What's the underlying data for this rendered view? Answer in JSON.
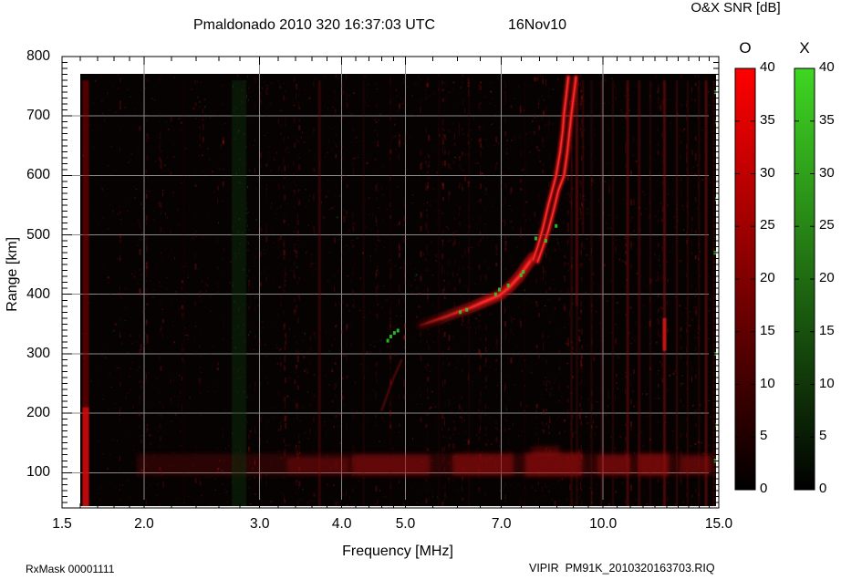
{
  "title": {
    "main": "Pmaldonado 2010 320 16:37:03 UTC",
    "date": "16Nov10"
  },
  "colorbar_title": "O&X SNR [dB]",
  "footer": {
    "left": "RxMask 00001111",
    "right": "VIPIR  PM91K_2010320163703.RIQ"
  },
  "axes": {
    "x": {
      "label": "Frequency [MHz]",
      "scale": "log",
      "min": 1.5,
      "max": 15.0,
      "tick_values": [
        1.5,
        2,
        3,
        4,
        5,
        7,
        10,
        15
      ],
      "tick_labels": [
        "1.5",
        "2.0",
        "3.0",
        "4.0",
        "5.0",
        "7.0",
        "10.0",
        "15.0"
      ],
      "minor_ticks": [
        1.6,
        1.7,
        1.8,
        1.9,
        2.2,
        2.4,
        2.6,
        2.8,
        3.2,
        3.4,
        3.6,
        3.8,
        4.2,
        4.4,
        4.6,
        4.8,
        5.5,
        6.0,
        6.5,
        7.5,
        8.0,
        8.5,
        9.0,
        9.5,
        10.5,
        11.0,
        11.5,
        12.0,
        12.5,
        13.0,
        13.5,
        14.0,
        14.5
      ],
      "grid_lines": [
        2,
        3,
        4,
        5,
        7,
        10
      ]
    },
    "y": {
      "label": "Range [km]",
      "scale": "linear",
      "min": 45,
      "max": 800,
      "tick_values": [
        800,
        700,
        600,
        500,
        400,
        300,
        200,
        100
      ],
      "tick_labels": [
        "800",
        "700",
        "600",
        "500",
        "400",
        "300",
        "200",
        "100"
      ],
      "minor_step": 10,
      "grid_lines": [
        100,
        200,
        300,
        400,
        500,
        600,
        700
      ]
    }
  },
  "colorbars": [
    {
      "header": "O",
      "mode": "ordinary",
      "top_color": "#ff0000",
      "bottom_color": "#000000",
      "min": 0,
      "max": 40,
      "tick_step": 5,
      "tick_labels": [
        "40",
        "35",
        "30",
        "25",
        "20",
        "15",
        "10",
        "5",
        "0"
      ]
    },
    {
      "header": "X",
      "mode": "extraordinary",
      "top_color": "#3fd623",
      "bottom_color": "#000000",
      "min": 0,
      "max": 40,
      "tick_step": 5,
      "tick_labels": [
        "40",
        "35",
        "30",
        "25",
        "20",
        "15",
        "10",
        "5",
        "0"
      ]
    }
  ],
  "colors": {
    "grid": "#8a8a8a",
    "frame": "#000000",
    "data_bg": "#060202",
    "o_mode": "#dd1515",
    "o_mode_bright": "#ff3333",
    "o_mode_dim": "#a80f0f",
    "x_mode": "#2ecc2e",
    "clutter": "#a81010"
  },
  "chart_data": {
    "type": "heatmap",
    "description": "VIPIR ionogram: O-mode (red) and X-mode (green) echo SNR [dB, 0-40] versus frequency [MHz, log 1.5-15] and virtual range [km, 45-800]. Units of series points: [frequency_MHz, range_km].",
    "data_extent": {
      "f_mhz": [
        1.62,
        14.95
      ],
      "range_km": [
        45,
        763
      ]
    },
    "o_trace_main": [
      [
        5.28,
        348
      ],
      [
        5.5,
        355
      ],
      [
        5.75,
        362
      ],
      [
        6.0,
        370
      ],
      [
        6.3,
        378
      ],
      [
        6.6,
        388
      ],
      [
        6.95,
        398
      ],
      [
        7.2,
        412
      ],
      [
        7.45,
        430
      ],
      [
        7.65,
        448
      ],
      [
        7.82,
        462
      ]
    ],
    "o_trace_inner_branch": [
      [
        7.82,
        458
      ],
      [
        7.95,
        480
      ],
      [
        8.1,
        512
      ],
      [
        8.25,
        550
      ],
      [
        8.38,
        578
      ],
      [
        8.48,
        600
      ],
      [
        8.6,
        640
      ],
      [
        8.68,
        675
      ],
      [
        8.72,
        704
      ],
      [
        8.8,
        740
      ],
      [
        8.85,
        765
      ]
    ],
    "o_trace_outer_branch": [
      [
        7.95,
        455
      ],
      [
        8.1,
        480
      ],
      [
        8.24,
        505
      ],
      [
        8.4,
        540
      ],
      [
        8.55,
        575
      ],
      [
        8.72,
        600
      ],
      [
        8.82,
        640
      ],
      [
        8.9,
        680
      ],
      [
        8.95,
        704
      ],
      [
        9.02,
        735
      ],
      [
        9.09,
        765
      ]
    ],
    "weak_echo_arc": [
      [
        4.6,
        205
      ],
      [
        4.66,
        222
      ],
      [
        4.73,
        242
      ],
      [
        4.8,
        260
      ],
      [
        4.87,
        275
      ],
      [
        4.93,
        289
      ]
    ],
    "x_mode_specks": [
      [
        4.7,
        322
      ],
      [
        4.75,
        329
      ],
      [
        4.81,
        335
      ],
      [
        4.87,
        339
      ],
      [
        6.06,
        370
      ],
      [
        6.2,
        374
      ],
      [
        6.86,
        400
      ],
      [
        6.95,
        408
      ],
      [
        7.17,
        415
      ],
      [
        7.5,
        432
      ],
      [
        7.56,
        438
      ],
      [
        7.9,
        494
      ],
      [
        8.18,
        490
      ],
      [
        8.48,
        515
      ],
      [
        14.82,
        120
      ],
      [
        14.9,
        180
      ],
      [
        14.85,
        300
      ],
      [
        14.92,
        395
      ],
      [
        14.8,
        470
      ],
      [
        14.88,
        560
      ],
      [
        14.9,
        690
      ],
      [
        14.84,
        740
      ]
    ],
    "clutter_band": {
      "base": {
        "f0": 1.95,
        "f1": 14.95,
        "k0": 95,
        "k1": 132,
        "o": 0.22
      },
      "blobs": [
        {
          "f0": 3.3,
          "f1": 4.1,
          "k0": 98,
          "k1": 126,
          "o": 0.3
        },
        {
          "f0": 4.15,
          "f1": 5.45,
          "k0": 96,
          "k1": 130,
          "o": 0.45
        },
        {
          "f0": 5.9,
          "f1": 7.3,
          "k0": 96,
          "k1": 132,
          "o": 0.5
        },
        {
          "f0": 7.6,
          "f1": 9.3,
          "k0": 94,
          "k1": 134,
          "o": 0.55
        },
        {
          "f0": 9.8,
          "f1": 11.0,
          "k0": 96,
          "k1": 130,
          "o": 0.5
        },
        {
          "f0": 11.3,
          "f1": 12.6,
          "k0": 95,
          "k1": 132,
          "o": 0.55
        },
        {
          "f0": 13.1,
          "f1": 14.6,
          "k0": 98,
          "k1": 128,
          "o": 0.4
        },
        {
          "f0": 7.8,
          "f1": 8.6,
          "k0": 128,
          "k1": 145,
          "o": 0.35
        }
      ]
    },
    "rfi_lines": [
      {
        "f": 1.63,
        "w": 7,
        "o": 0.5,
        "c": "#990000",
        "k0": 42,
        "k1": 760
      },
      {
        "f": 1.63,
        "w": 7,
        "o": 0.85,
        "c": "#cc0f0f",
        "k0": 42,
        "k1": 210
      },
      {
        "f": 2.79,
        "w": 16,
        "o": 0.45,
        "c": "#0c300c",
        "k0": 42,
        "k1": 760
      },
      {
        "f": 3.7,
        "w": 3,
        "o": 0.4,
        "c": "#6b0808",
        "k0": 42,
        "k1": 760
      },
      {
        "f": 4.32,
        "w": 2,
        "o": 0.25,
        "c": "#5e0707",
        "k0": 42,
        "k1": 760
      },
      {
        "f": 5.62,
        "w": 1.5,
        "o": 0.2,
        "c": "#5e0707",
        "k0": 42,
        "k1": 760
      },
      {
        "f": 6.25,
        "w": 1.5,
        "o": 0.2,
        "c": "#5e0707",
        "k0": 42,
        "k1": 760
      },
      {
        "f": 8.95,
        "w": 2,
        "o": 0.35,
        "c": "#7a0a0a",
        "k0": 42,
        "k1": 760
      },
      {
        "f": 9.12,
        "w": 3,
        "o": 0.5,
        "c": "#8f0d0d",
        "k0": 380,
        "k1": 760
      },
      {
        "f": 9.12,
        "w": 2,
        "o": 0.3,
        "c": "#7a0a0a",
        "k0": 42,
        "k1": 380
      },
      {
        "f": 9.32,
        "w": 2,
        "o": 0.4,
        "c": "#7a0a0a",
        "k0": 500,
        "k1": 760
      },
      {
        "f": 9.6,
        "w": 2,
        "o": 0.3,
        "c": "#6b0808",
        "k0": 42,
        "k1": 760
      },
      {
        "f": 9.95,
        "w": 2,
        "o": 0.35,
        "c": "#7a0a0a",
        "k0": 42,
        "k1": 760
      },
      {
        "f": 10.35,
        "w": 2,
        "o": 0.3,
        "c": "#6b0808",
        "k0": 42,
        "k1": 760
      },
      {
        "f": 10.9,
        "w": 3,
        "o": 0.45,
        "c": "#8f0d0d",
        "k0": 42,
        "k1": 760
      },
      {
        "f": 11.35,
        "w": 3,
        "o": 0.4,
        "c": "#7a0a0a",
        "k0": 42,
        "k1": 760
      },
      {
        "f": 11.8,
        "w": 2,
        "o": 0.3,
        "c": "#6b0808",
        "k0": 42,
        "k1": 760
      },
      {
        "f": 12.4,
        "w": 3,
        "o": 0.5,
        "c": "#8f0d0d",
        "k0": 42,
        "k1": 760
      },
      {
        "f": 12.4,
        "w": 4,
        "o": 0.9,
        "c": "#d41414",
        "k0": 305,
        "k1": 360
      },
      {
        "f": 12.95,
        "w": 2,
        "o": 0.4,
        "c": "#7a0a0a",
        "k0": 42,
        "k1": 760
      },
      {
        "f": 13.45,
        "w": 2,
        "o": 0.35,
        "c": "#6b0808",
        "k0": 42,
        "k1": 760
      },
      {
        "f": 14.0,
        "w": 2,
        "o": 0.3,
        "c": "#6b0808",
        "k0": 42,
        "k1": 760
      },
      {
        "f": 14.35,
        "w": 3,
        "o": 0.5,
        "c": "#8f0d0d",
        "k0": 42,
        "k1": 760
      },
      {
        "f": 14.75,
        "w": 2,
        "o": 0.35,
        "c": "#7a0a0a",
        "k0": 42,
        "k1": 760
      },
      {
        "f": 2.3,
        "w": 1.5,
        "o": 0.15,
        "c": "#550606",
        "k0": 42,
        "k1": 760
      },
      {
        "f": 4.75,
        "w": 1.5,
        "o": 0.18,
        "c": "#550606",
        "k0": 42,
        "k1": 760
      },
      {
        "f": 7.6,
        "w": 1.5,
        "o": 0.15,
        "c": "#550606",
        "k0": 42,
        "k1": 760
      }
    ],
    "noise": {
      "seed": 42,
      "red_speckle": 2400,
      "green_fraction": 0.07,
      "striation_columns": 110,
      "green_band_mhz": [
        2.72,
        2.9
      ],
      "green_band_specks": 130
    }
  }
}
